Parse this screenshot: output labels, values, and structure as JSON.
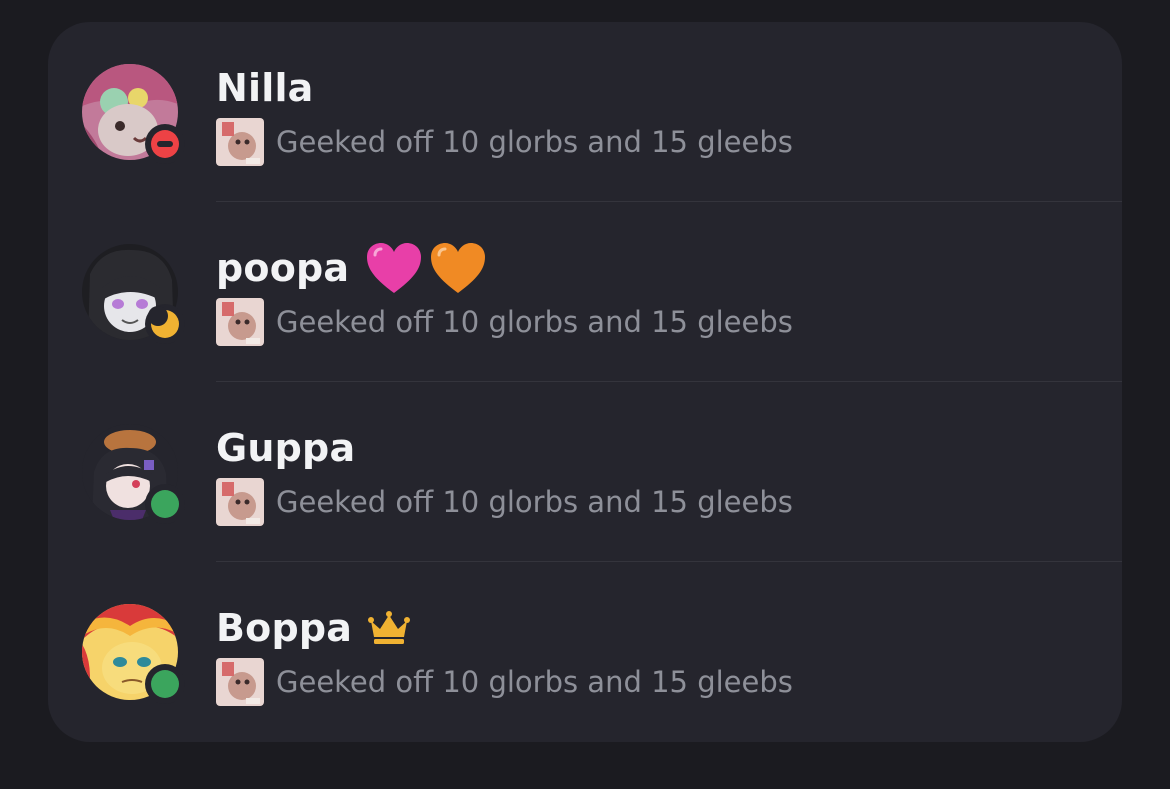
{
  "members": [
    {
      "name": "Nilla",
      "status": "dnd",
      "status_icon": "do-not-disturb-icon",
      "badges": [],
      "activity": "Geeked off 10 glorbs and 15 gleebs",
      "avatar_icon": "anime-avatar-pink-hair"
    },
    {
      "name": "poopa",
      "status": "idle",
      "status_icon": "idle-moon-icon",
      "badges": [
        "pink-heart-icon",
        "orange-heart-icon"
      ],
      "activity": "Geeked off 10 glorbs and 15 gleebs",
      "avatar_icon": "anime-avatar-dark-hair"
    },
    {
      "name": "Guppa",
      "status": "online",
      "status_icon": "online-dot-icon",
      "badges": [],
      "activity": "Geeked off 10 glorbs and 15 gleebs",
      "avatar_icon": "anime-avatar-with-cat"
    },
    {
      "name": "Boppa",
      "status": "online",
      "status_icon": "online-dot-icon",
      "badges": [
        "crown-icon"
      ],
      "activity": "Geeked off 10 glorbs and 15 gleebs",
      "avatar_icon": "pony-avatar-sunset-hair"
    }
  ],
  "colors": {
    "background": "#1b1b20",
    "card": "#25252d",
    "name_text": "#f2f3f5",
    "activity_text": "#8e9099",
    "online": "#3ba55d",
    "dnd": "#ed4245",
    "idle": "#f0b232",
    "pink_heart": "#e83fa8",
    "orange_heart": "#f08a24",
    "crown": "#f0b232"
  }
}
